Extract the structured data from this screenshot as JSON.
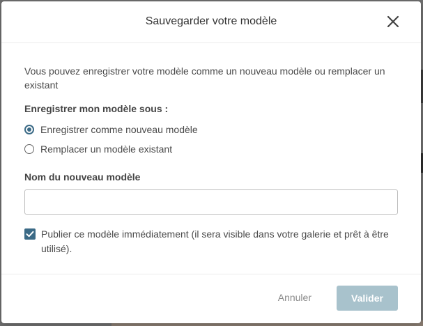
{
  "dialog": {
    "title": "Sauvegarder votre modèle",
    "intro": "Vous pouvez enregistrer votre modèle comme un nouveau modèle ou remplacer un existant",
    "save_as_label": "Enregistrer mon modèle sous :",
    "options": [
      {
        "label": "Enregistrer comme nouveau modèle",
        "checked": true
      },
      {
        "label": "Remplacer un modèle existant",
        "checked": false
      }
    ],
    "name_label": "Nom du nouveau modèle",
    "name_value": "",
    "name_placeholder": "",
    "publish_label": "Publier ce modèle immédiatement (il sera visible dans votre galerie et prêt à être utilisé).",
    "publish_checked": true,
    "cancel_label": "Annuler",
    "validate_label": "Valider"
  },
  "icons": {
    "close": "close-icon",
    "check": "checkmark-icon"
  },
  "colors": {
    "accent": "#3b6a86",
    "validate_disabled": "#a8c2cc",
    "overlay": "#6f6f6f"
  }
}
